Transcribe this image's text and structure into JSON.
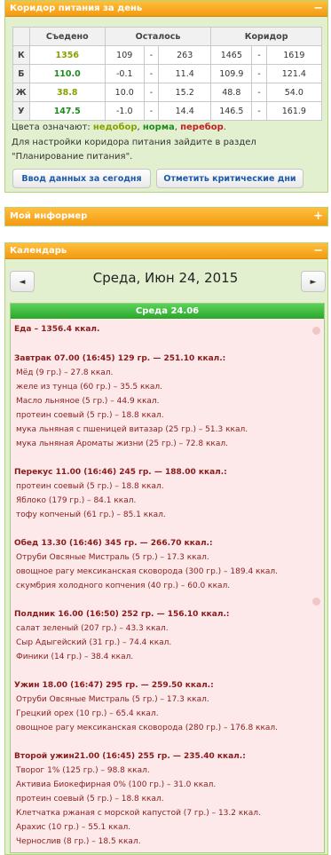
{
  "corridor": {
    "title": "Коридор питания за день",
    "toggle": "−",
    "headers": {
      "blank": "",
      "eaten": "Съедено",
      "left": "Осталось",
      "corridor": "Коридор"
    },
    "rows": [
      {
        "label": "К",
        "eaten": "1356",
        "eaten_color": "#8aa000",
        "left_min": "109",
        "dash1": "-",
        "left_max": "263",
        "cor_min": "1465",
        "dash2": "-",
        "cor_max": "1619"
      },
      {
        "label": "Б",
        "eaten": "110.0",
        "eaten_color": "#1f8b1f",
        "left_min": "-0.1",
        "dash1": "-",
        "left_max": "11.4",
        "cor_min": "109.9",
        "dash2": "-",
        "cor_max": "121.4"
      },
      {
        "label": "Ж",
        "eaten": "38.8",
        "eaten_color": "#8aa000",
        "left_min": "10.0",
        "dash1": "-",
        "left_max": "15.2",
        "cor_min": "48.8",
        "dash2": "-",
        "cor_max": "54.0"
      },
      {
        "label": "У",
        "eaten": "147.5",
        "eaten_color": "#1f8b1f",
        "left_min": "-1.0",
        "dash1": "-",
        "left_max": "14.4",
        "cor_min": "146.5",
        "dash2": "-",
        "cor_max": "161.9"
      }
    ],
    "legend_prefix": "Цвета означают: ",
    "legend_under": "недобор",
    "legend_sep1": ", ",
    "legend_norm": "норма",
    "legend_sep2": ", ",
    "legend_over": "перебор",
    "legend_end": ".",
    "colors": {
      "under": "#8aa000",
      "norm": "#1f8b1f",
      "over": "#c02020"
    },
    "note_line1": "Для настройки коридора питания зайдите в раздел",
    "note_line2": "\"Планирование питания\".",
    "btn_today": "Ввод данных за сегодня",
    "btn_critical": "Отметить критические дни"
  },
  "informer": {
    "title": "Мой информер",
    "toggle": "+"
  },
  "calendar": {
    "title": "Календарь",
    "toggle": "−",
    "prev": "◄",
    "next": "►",
    "date": "Среда, Июн 24, 2015",
    "day_header": "Среда 24.06"
  },
  "diary": [
    {
      "text": "Еда – 1356.4 ккал.",
      "head": false
    },
    {
      "text": "Завтрак 07.00 (16:45) 129 гр. — 251.10 ккал.:",
      "head": true
    },
    {
      "text": "Мёд (9 гр.) – 27.8 ккал.",
      "head": false
    },
    {
      "text": "желе из тунца (60 гр.) – 35.5 ккал.",
      "head": false
    },
    {
      "text": "Масло льняное (5 гр.) – 44.9 ккал.",
      "head": false
    },
    {
      "text": "протеин соевый (5 гр.) – 18.8 ккал.",
      "head": false
    },
    {
      "text": "мука льняная с пшеницей витазар (25 гр.) – 51.3 ккал.",
      "head": false
    },
    {
      "text": "мука льняная Ароматы жизни (25 гр.) – 72.8 ккал.",
      "head": false
    },
    {
      "text": "Перекус 11.00 (16:46) 245 гр. — 188.00 ккал.:",
      "head": true
    },
    {
      "text": "протеин соевый (5 гр.) – 18.8 ккал.",
      "head": false
    },
    {
      "text": "Яблоко (179 гр.) – 84.1 ккал.",
      "head": false
    },
    {
      "text": "тофу копченый (61 гр.) – 85.1 ккал.",
      "head": false
    },
    {
      "text": "Обед 13.30 (16:46) 345 гр. — 266.70 ккал.:",
      "head": true
    },
    {
      "text": "Отруби Овсяные Мистраль (5 гр.) – 17.3 ккал.",
      "head": false
    },
    {
      "text": "овощное рагу мексиканская сковорода (300 гр.) – 189.4 ккал.",
      "head": false
    },
    {
      "text": "скумбрия холодного копчения (40 гр.) – 60.0 ккал.",
      "head": false
    },
    {
      "text": "Полдник 16.00 (16:50) 252 гр. — 156.10 ккал.:",
      "head": true
    },
    {
      "text": "салат зеленый (207 гр.) – 43.3 ккал.",
      "head": false
    },
    {
      "text": "Сыр Адыгейский (31 гр.) – 74.4 ккал.",
      "head": false
    },
    {
      "text": "Финики (14 гр.) – 38.4 ккал.",
      "head": false
    },
    {
      "text": "Ужин 18.00 (16:47) 295 гр. — 259.50 ккал.:",
      "head": true
    },
    {
      "text": "Отруби Овсяные Мистраль (5 гр.) – 17.3 ккал.",
      "head": false
    },
    {
      "text": "Грецкий орех (10 гр.) – 65.4 ккал.",
      "head": false
    },
    {
      "text": "овощное рагу мексиканская сковорода (280 гр.) – 176.8 ккал.",
      "head": false
    },
    {
      "text": "Второй ужин21.00 (16:45) 255 гр. — 235.40 ккал.:",
      "head": true
    },
    {
      "text": "Творог 1% (125 гр.) – 98.8 ккал.",
      "head": false
    },
    {
      "text": "Активиа Биокефирная 0% (100 гр.) – 31.0 ккал.",
      "head": false
    },
    {
      "text": "протеин соевый (5 гр.) – 18.8 ккал.",
      "head": false
    },
    {
      "text": "Клетчатка ржаная с морской капустой (7 гр.) – 13.2 ккал.",
      "head": false
    },
    {
      "text": "Арахис (10 гр.) – 55.1 ккал.",
      "head": false
    },
    {
      "text": "Чернослив (8 гр.) – 18.5 ккал.",
      "head": false
    }
  ]
}
